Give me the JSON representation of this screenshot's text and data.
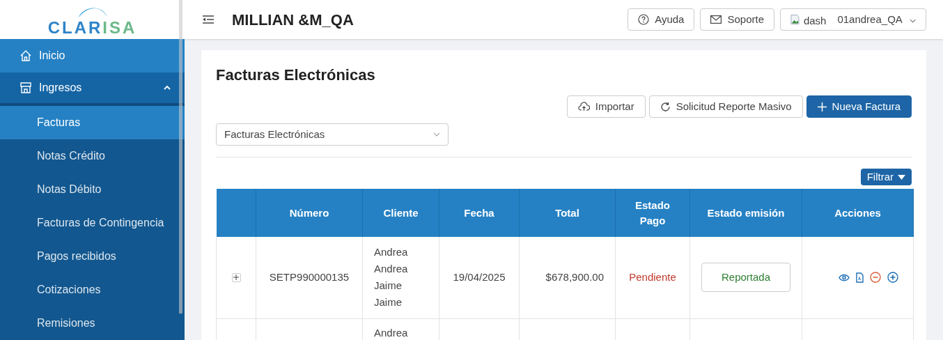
{
  "logo": {
    "text_primary": "CLAR",
    "text_accent": "ISA"
  },
  "sidebar": {
    "items": [
      {
        "kind": "home",
        "label": "Inicio",
        "selected": false
      },
      {
        "kind": "store",
        "label": "Ingresos",
        "selected": false,
        "expanded": true,
        "children": [
          {
            "label": "Facturas",
            "selected": true
          },
          {
            "label": "Notas Crédito",
            "selected": false
          },
          {
            "label": "Notas Débito",
            "selected": false
          },
          {
            "label": "Facturas de Contingencia",
            "selected": false
          },
          {
            "label": "Pagos recibidos",
            "selected": false
          },
          {
            "label": "Cotizaciones",
            "selected": false
          },
          {
            "label": "Remisiones",
            "selected": false
          }
        ]
      }
    ]
  },
  "header": {
    "title": "MILLIAN &M_QA",
    "help": "Ayuda",
    "support": "Soporte",
    "avatar_alt": "dash",
    "user": "01andrea_QA"
  },
  "page": {
    "title": "Facturas Electrónicas",
    "actions": [
      {
        "kind": "import",
        "label": "Importar"
      },
      {
        "kind": "refresh",
        "label": "Solicitud Reporte Masivo"
      },
      {
        "kind": "primary",
        "label": "Nueva Factura"
      }
    ],
    "select": {
      "value": "Facturas Electrónicas"
    },
    "filter": "Filtrar"
  },
  "table": {
    "columns": [
      "",
      "Número",
      "Cliente",
      "Fecha",
      "Total",
      "Estado Pago",
      "Estado emisión",
      "Acciones"
    ],
    "rows": [
      {
        "numero": "SETP990000135",
        "cliente": [
          "Andrea",
          "Andrea",
          "Jaime",
          "Jaime"
        ],
        "fecha": "19/04/2025",
        "total": "$678,900.00",
        "estado_pago": "Pendiente",
        "estado_emision": "Reportada"
      },
      {
        "cliente": [
          "Andrea"
        ]
      }
    ]
  }
}
